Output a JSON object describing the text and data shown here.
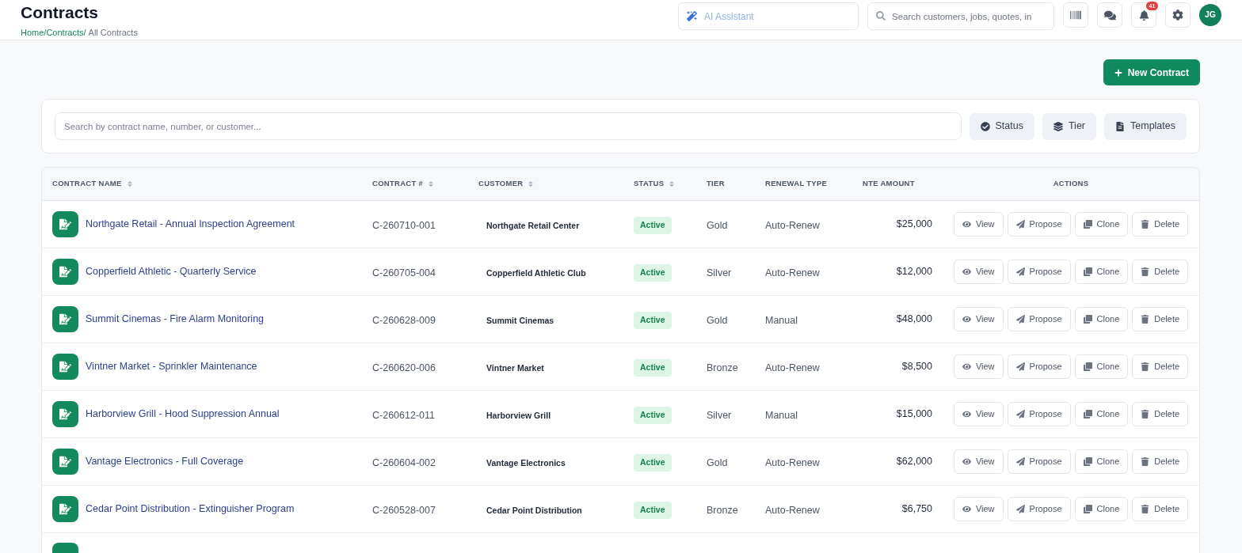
{
  "header": {
    "title": "Contracts",
    "breadcrumb": {
      "separator": "/",
      "links": [
        "Home",
        "Contracts"
      ],
      "current": "All Contracts"
    },
    "ai_assistant": {
      "placeholder": "AI Assistant"
    },
    "search": {
      "placeholder": "Search customers, jobs, quotes, in"
    },
    "notifications": {
      "count": "41"
    },
    "avatar": {
      "initials": "JG"
    }
  },
  "new_contract_button": {
    "label": "New Contract"
  },
  "filters": {
    "search": {
      "placeholder": "Search by contract name, number, or customer..."
    },
    "buttons": [
      {
        "label": "Status",
        "kind": "status"
      },
      {
        "label": "Tier",
        "kind": "tier"
      },
      {
        "label": "Templates",
        "kind": "templates"
      }
    ]
  },
  "table": {
    "columns": [
      {
        "label": "CONTRACT NAME",
        "sortable": true
      },
      {
        "label": "CONTRACT #",
        "sortable": true
      },
      {
        "label": "CUSTOMER",
        "sortable": true
      },
      {
        "label": "STATUS",
        "sortable": true
      },
      {
        "label": "TIER",
        "sortable": false
      },
      {
        "label": "RENEWAL TYPE",
        "sortable": false
      },
      {
        "label": "NTE AMOUNT",
        "sortable": false
      },
      {
        "label": "ACTIONS",
        "sortable": false
      }
    ],
    "rows": [
      {
        "name": "Northgate Retail - Annual Inspection Agreement",
        "number": "C-260710-001",
        "customer": "Northgate Retail Center",
        "status": "Active",
        "tier": "Gold",
        "renewal": "Auto-Renew",
        "amount": "$25,000",
        "actions": [
          {
            "label": "View",
            "kind": "view"
          },
          {
            "label": "Propose",
            "kind": "propose"
          },
          {
            "label": "Clone",
            "kind": "clone"
          },
          {
            "label": "Delete",
            "kind": "delete"
          }
        ]
      },
      {
        "name": "Copperfield Athletic - Quarterly Service",
        "number": "C-260705-004",
        "customer": "Copperfield Athletic Club",
        "status": "Active",
        "tier": "Silver",
        "renewal": "Auto-Renew",
        "amount": "$12,000",
        "actions": [
          {
            "label": "View",
            "kind": "view"
          },
          {
            "label": "Propose",
            "kind": "propose"
          },
          {
            "label": "Clone",
            "kind": "clone"
          },
          {
            "label": "Delete",
            "kind": "delete"
          }
        ]
      },
      {
        "name": "Summit Cinemas - Fire Alarm Monitoring",
        "number": "C-260628-009",
        "customer": "Summit Cinemas",
        "status": "Active",
        "tier": "Gold",
        "renewal": "Manual",
        "amount": "$48,000",
        "actions": [
          {
            "label": "View",
            "kind": "view"
          },
          {
            "label": "Propose",
            "kind": "propose"
          },
          {
            "label": "Clone",
            "kind": "clone"
          },
          {
            "label": "Delete",
            "kind": "delete"
          }
        ]
      },
      {
        "name": "Vintner Market - Sprinkler Maintenance",
        "number": "C-260620-006",
        "customer": "Vintner Market",
        "status": "Active",
        "tier": "Bronze",
        "renewal": "Auto-Renew",
        "amount": "$8,500",
        "actions": [
          {
            "label": "View",
            "kind": "view"
          },
          {
            "label": "Propose",
            "kind": "propose"
          },
          {
            "label": "Clone",
            "kind": "clone"
          },
          {
            "label": "Delete",
            "kind": "delete"
          }
        ]
      },
      {
        "name": "Harborview Grill - Hood Suppression Annual",
        "number": "C-260612-011",
        "customer": "Harborview Grill",
        "status": "Active",
        "tier": "Silver",
        "renewal": "Manual",
        "amount": "$15,000",
        "actions": [
          {
            "label": "View",
            "kind": "view"
          },
          {
            "label": "Propose",
            "kind": "propose"
          },
          {
            "label": "Clone",
            "kind": "clone"
          },
          {
            "label": "Delete",
            "kind": "delete"
          }
        ]
      },
      {
        "name": "Vantage Electronics - Full Coverage",
        "number": "C-260604-002",
        "customer": "Vantage Electronics",
        "status": "Active",
        "tier": "Gold",
        "renewal": "Auto-Renew",
        "amount": "$62,000",
        "actions": [
          {
            "label": "View",
            "kind": "view"
          },
          {
            "label": "Propose",
            "kind": "propose"
          },
          {
            "label": "Clone",
            "kind": "clone"
          },
          {
            "label": "Delete",
            "kind": "delete"
          }
        ]
      },
      {
        "name": "Cedar Point Distribution - Extinguisher Program",
        "number": "C-260528-007",
        "customer": "Cedar Point Distribution",
        "status": "Active",
        "tier": "Bronze",
        "renewal": "Auto-Renew",
        "amount": "$6,750",
        "actions": [
          {
            "label": "View",
            "kind": "view"
          },
          {
            "label": "Propose",
            "kind": "propose"
          },
          {
            "label": "Clone",
            "kind": "clone"
          },
          {
            "label": "Delete",
            "kind": "delete"
          }
        ]
      }
    ],
    "more_rows_below": true
  }
}
